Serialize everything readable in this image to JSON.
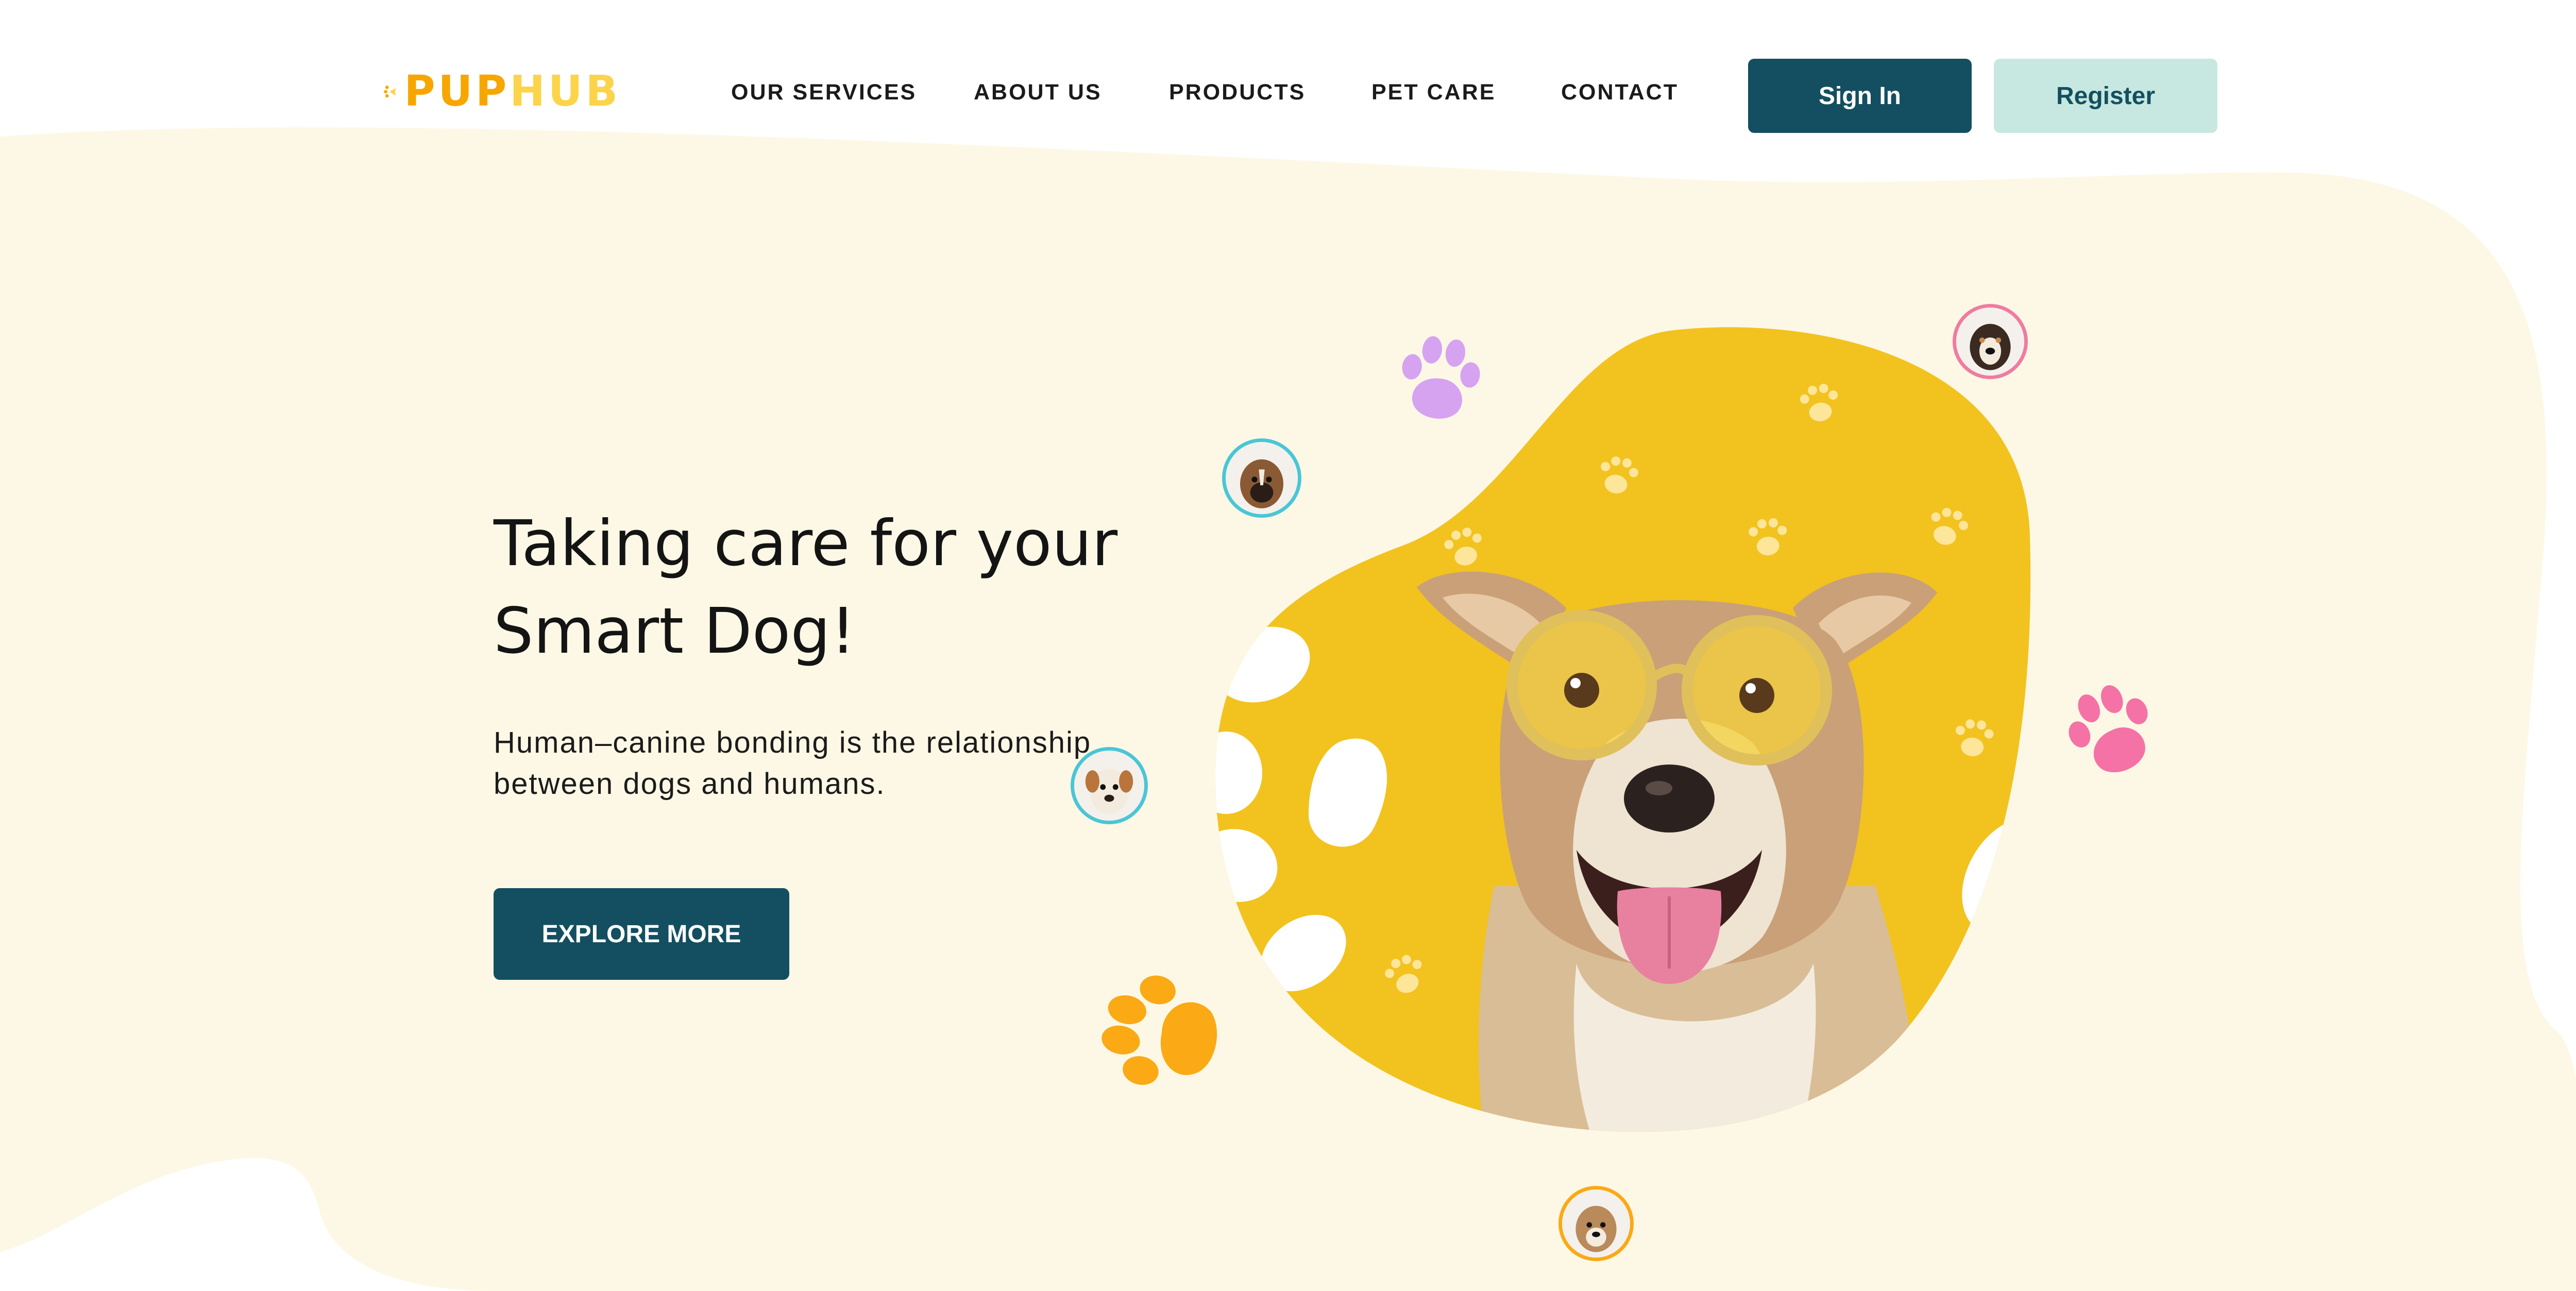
{
  "brand": {
    "name_part1": "PUP",
    "name_part2": "HUB",
    "colors": {
      "primary": "#f7a600",
      "secondary": "#fcd44a"
    }
  },
  "nav": {
    "items": [
      {
        "label": "OUR SERVICES"
      },
      {
        "label": "ABOUT US"
      },
      {
        "label": "PRODUCTS"
      },
      {
        "label": "PET CARE"
      },
      {
        "label": "CONTACT"
      }
    ]
  },
  "auth": {
    "signin_label": "Sign In",
    "register_label": "Register"
  },
  "hero": {
    "title_line1": "Taking care for your",
    "title_line2": "Smart Dog!",
    "description_line1": "Human–canine bonding is the relationship",
    "description_line2": "between dogs and humans.",
    "cta_label": "EXPLORE MORE"
  },
  "theme": {
    "accent": "#134f60",
    "accent_light": "#c7e8e0",
    "background_blob": "#fdf8e6",
    "hero_blob": "#f2c21f",
    "paw_purple": "#d6a3f0",
    "paw_pink": "#f472a6",
    "paw_orange": "#fba914"
  },
  "icons": {
    "logo": "paw-logo-icon",
    "decorations": [
      "purple-paw-icon",
      "pink-paw-icon",
      "orange-paw-icon"
    ],
    "avatars": [
      "dog-avatar-icon"
    ]
  }
}
